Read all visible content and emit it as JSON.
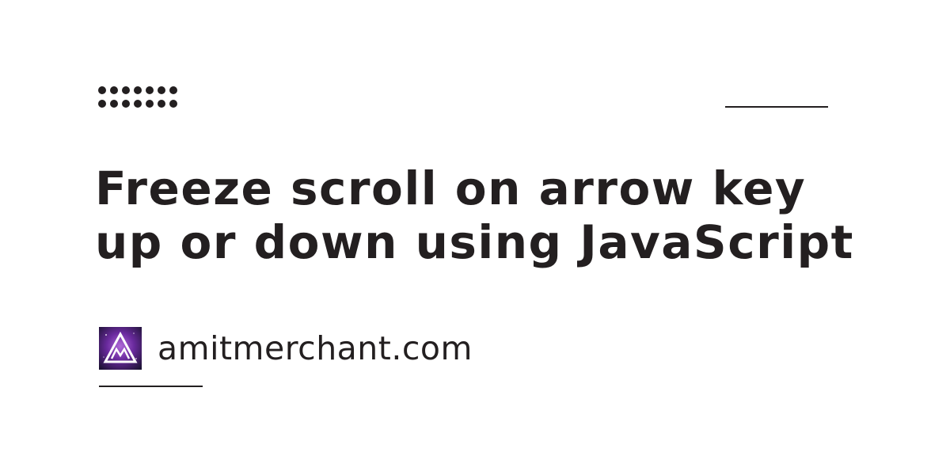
{
  "title": {
    "line1": "Freeze scroll on arrow key",
    "line2": "up or down using JavaScript"
  },
  "brand": {
    "site_name": "amitmerchant.com",
    "logo_icon": "mountain-triangle-logo-icon"
  },
  "colors": {
    "text": "#231f20",
    "background": "#ffffff",
    "logo_purple": "#7b2fa8",
    "logo_dark": "#1c1233"
  }
}
